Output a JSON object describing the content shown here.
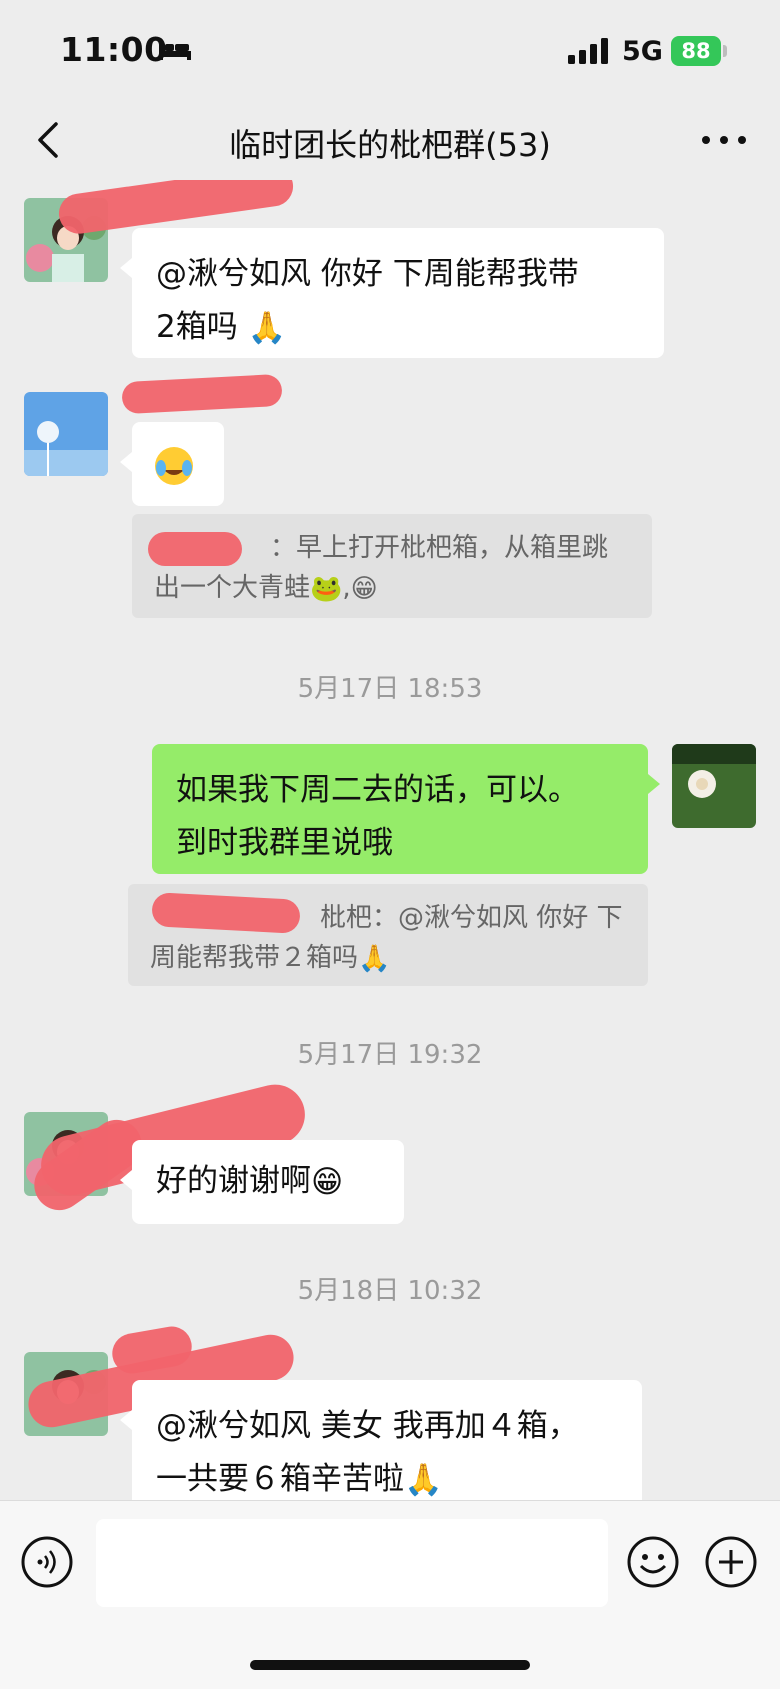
{
  "status_bar": {
    "time": "11:00",
    "network": "5G",
    "battery": "88"
  },
  "nav": {
    "title": "临时团长的枇杷群(53)"
  },
  "messages": {
    "m1": {
      "text_line1": "@湫兮如风 你好 下周能帮我带",
      "text_line2": "2箱吗"
    },
    "m2_quote": {
      "line1": "：早上打开枇杷箱，从箱里跳",
      "line2": "出一个大青蛙"
    },
    "ts1": "5月17日 18:53",
    "m3": {
      "text_line1": "如果我下周二去的话，可以。",
      "text_line2": "到时我群里说哦"
    },
    "m3_quote": {
      "line1": "枇杷：@湫兮如风 你好 下",
      "line2": "周能帮我带２箱吗"
    },
    "ts2": "5月17日 19:32",
    "m4": {
      "text": "好的谢谢啊"
    },
    "ts3": "5月18日 10:32",
    "m5": {
      "text_line1": "@湫兮如风 美女 我再加４箱，",
      "text_line2": "一共要６箱辛苦啦"
    }
  },
  "colors": {
    "bubble_green": "#95ec69",
    "redaction": "#f1646c"
  },
  "icons": [
    "bed-icon",
    "signal-icon",
    "back-icon",
    "more-icon",
    "voice-icon",
    "emoji-icon",
    "plus-icon"
  ]
}
